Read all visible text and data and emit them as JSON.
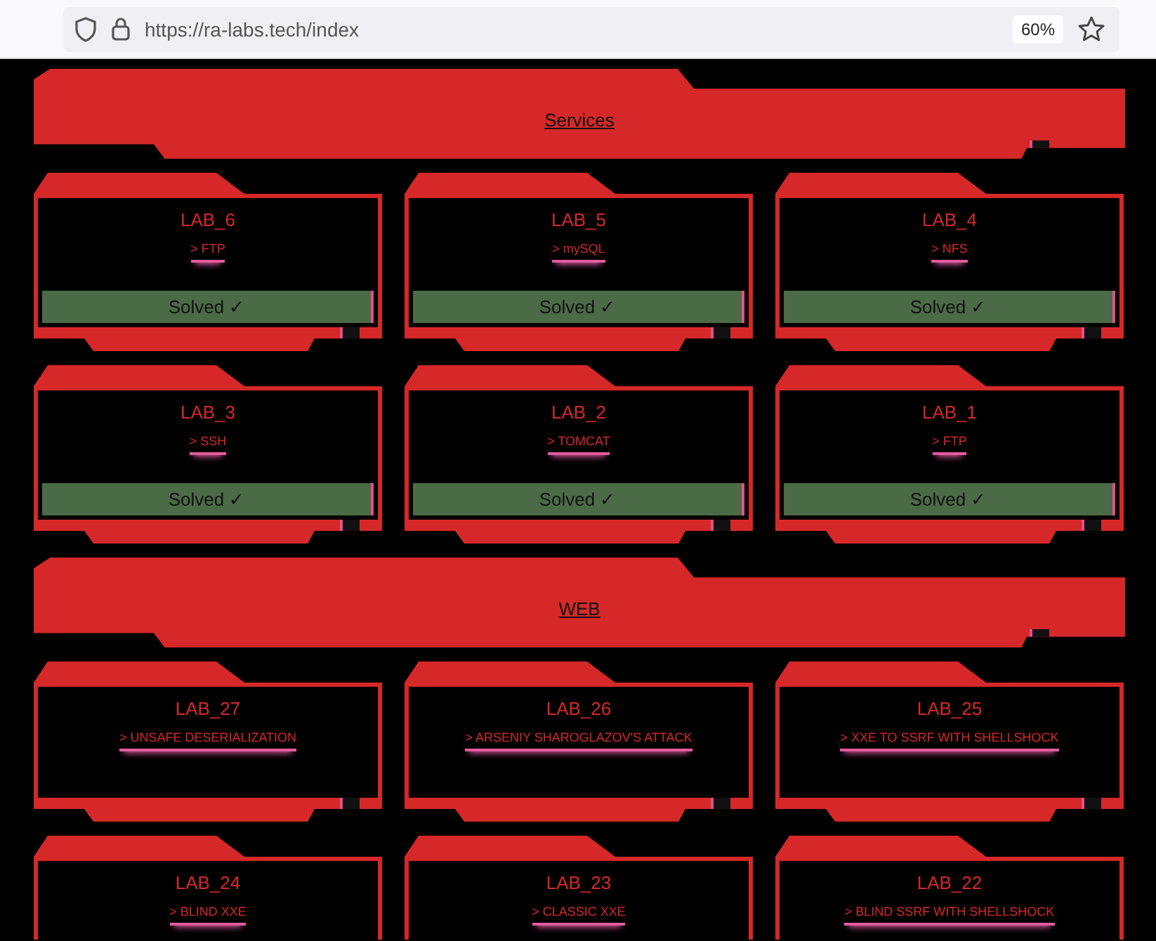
{
  "browser": {
    "url": "https://ra-labs.tech/index",
    "zoom": "60%"
  },
  "sections": [
    {
      "title": "Services",
      "labs": [
        {
          "title": "LAB_6",
          "link": "> FTP",
          "status": "Solved ✓"
        },
        {
          "title": "LAB_5",
          "link": "> mySQL",
          "status": "Solved ✓"
        },
        {
          "title": "LAB_4",
          "link": "> NFS",
          "status": "Solved ✓"
        },
        {
          "title": "LAB_3",
          "link": "> SSH",
          "status": "Solved ✓"
        },
        {
          "title": "LAB_2",
          "link": "> TOMCAT",
          "status": "Solved ✓"
        },
        {
          "title": "LAB_1",
          "link": "> FTP",
          "status": "Solved ✓"
        }
      ]
    },
    {
      "title": "WEB",
      "labs": [
        {
          "title": "LAB_27",
          "link": "> UNSAFE DESERIALIZATION"
        },
        {
          "title": "LAB_26",
          "link": "> ARSENIY SHAROGLAZOV'S ATTACK"
        },
        {
          "title": "LAB_25",
          "link": "> XXE TO SSRF WITH SHELLSHOCK"
        },
        {
          "title": "LAB_24",
          "link": "> BLIND XXE"
        },
        {
          "title": "LAB_23",
          "link": "> CLASSIC XXE"
        },
        {
          "title": "LAB_22",
          "link": "> BLIND SSRF WITH SHELLSHOCK"
        }
      ]
    }
  ]
}
